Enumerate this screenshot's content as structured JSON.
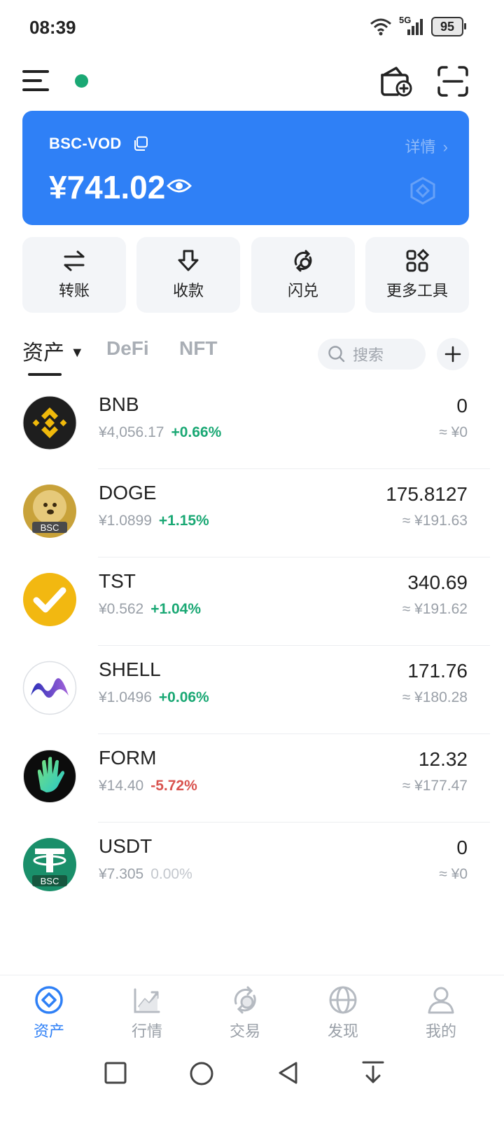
{
  "status": {
    "time": "08:39",
    "network": "5G",
    "battery": "95"
  },
  "header": {
    "menu_icon": "menu-icon",
    "online_color": "#1aa874",
    "wallet_add_icon": "wallet-add-icon",
    "scan_icon": "scan-icon"
  },
  "card": {
    "name": "BSC-VOD",
    "detail": "详情",
    "balance": "¥741.02",
    "bg_color": "#2f80f6"
  },
  "actions": [
    {
      "label": "转账",
      "icon": "transfer-icon"
    },
    {
      "label": "收款",
      "icon": "receive-icon"
    },
    {
      "label": "闪兑",
      "icon": "swap-icon"
    },
    {
      "label": "更多工具",
      "icon": "more-tools-icon"
    }
  ],
  "tabs": {
    "assets": "资产",
    "defi": "DeFi",
    "nft": "NFT"
  },
  "search": {
    "placeholder": "搜索"
  },
  "tokens": [
    {
      "symbol": "BNB",
      "price": "¥4,056.17",
      "change": "+0.66%",
      "amount": "0",
      "value": "≈ ¥0"
    },
    {
      "symbol": "DOGE",
      "price": "¥1.0899",
      "change": "+1.15%",
      "amount": "175.8127",
      "value": "≈ ¥191.63"
    },
    {
      "symbol": "TST",
      "price": "¥0.562",
      "change": "+1.04%",
      "amount": "340.69",
      "value": "≈ ¥191.62"
    },
    {
      "symbol": "SHELL",
      "price": "¥1.0496",
      "change": "+0.06%",
      "amount": "171.76",
      "value": "≈ ¥180.28"
    },
    {
      "symbol": "FORM",
      "price": "¥14.40",
      "change": "-5.72%",
      "amount": "12.32",
      "value": "≈ ¥177.47"
    },
    {
      "symbol": "USDT",
      "price": "¥7.305",
      "change": "0.00%",
      "amount": "0",
      "value": "≈ ¥0"
    }
  ],
  "colors": {
    "up": "#1aa874",
    "down": "#d9534f",
    "flat": "#c3c7cd",
    "accent": "#2f80f6"
  },
  "nav": [
    {
      "label": "资产",
      "icon": "assets-icon",
      "active": true
    },
    {
      "label": "行情",
      "icon": "market-icon"
    },
    {
      "label": "交易",
      "icon": "trade-icon"
    },
    {
      "label": "发现",
      "icon": "discover-icon"
    },
    {
      "label": "我的",
      "icon": "profile-icon"
    }
  ]
}
